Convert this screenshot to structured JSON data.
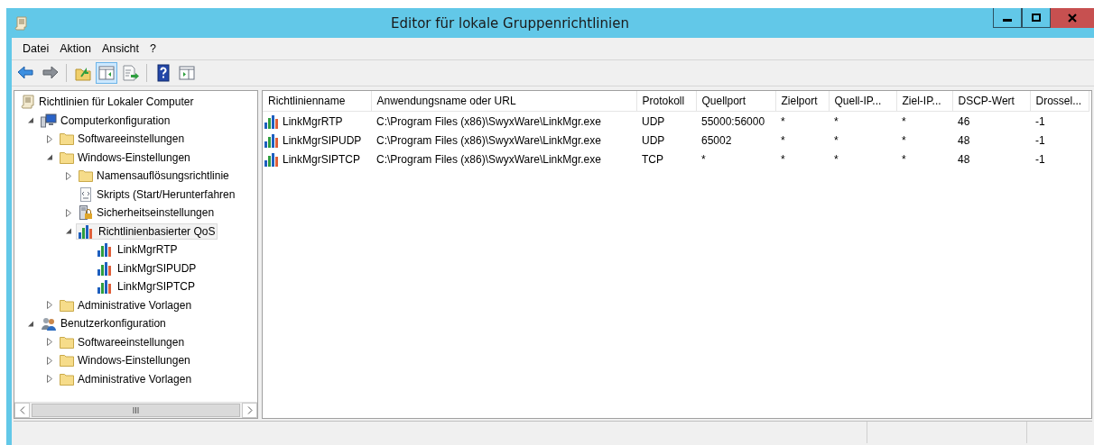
{
  "window": {
    "title": "Editor für lokale Gruppenrichtlinien"
  },
  "menu": [
    "Datei",
    "Aktion",
    "Ansicht",
    "?"
  ],
  "toolbar": [
    {
      "kind": "back",
      "pressed": false
    },
    {
      "kind": "forward",
      "pressed": false
    },
    {
      "kind": "sep"
    },
    {
      "kind": "up",
      "pressed": false
    },
    {
      "kind": "tree",
      "pressed": true
    },
    {
      "kind": "export",
      "pressed": false
    },
    {
      "kind": "sep"
    },
    {
      "kind": "help",
      "pressed": false
    },
    {
      "kind": "actionpane",
      "pressed": false
    }
  ],
  "tree": [
    {
      "label": "Richtlinien für Lokaler Computer",
      "kind": "scroll",
      "selected": false,
      "children": [
        {
          "label": "Computerkonfiguration",
          "kind": "computer",
          "expanded": true,
          "selected": false,
          "children": [
            {
              "label": "Softwareeinstellungen",
              "kind": "folder",
              "expanded": false,
              "selected": false
            },
            {
              "label": "Windows-Einstellungen",
              "kind": "folder",
              "expanded": true,
              "selected": false,
              "children": [
                {
                  "label": "Namensauflösungsrichtlinie",
                  "kind": "folder",
                  "expanded": false,
                  "selected": false
                },
                {
                  "label": "Skripts (Start/Herunterfahren",
                  "kind": "script",
                  "selected": false
                },
                {
                  "label": "Sicherheitseinstellungen",
                  "kind": "security",
                  "expanded": false,
                  "selected": false
                },
                {
                  "label": "Richtlinienbasierter QoS",
                  "kind": "qos",
                  "expanded": true,
                  "selected": true,
                  "children": [
                    {
                      "label": "LinkMgrRTP",
                      "kind": "qos",
                      "selected": false
                    },
                    {
                      "label": "LinkMgrSIPUDP",
                      "kind": "qos",
                      "selected": false
                    },
                    {
                      "label": "LinkMgrSIPTCP",
                      "kind": "qos",
                      "selected": false
                    }
                  ]
                }
              ]
            },
            {
              "label": "Administrative Vorlagen",
              "kind": "folder",
              "expanded": false,
              "selected": false
            }
          ]
        },
        {
          "label": "Benutzerkonfiguration",
          "kind": "user",
          "expanded": true,
          "selected": false,
          "children": [
            {
              "label": "Softwareeinstellungen",
              "kind": "folder",
              "expanded": false,
              "selected": false
            },
            {
              "label": "Windows-Einstellungen",
              "kind": "folder",
              "expanded": false,
              "selected": false
            },
            {
              "label": "Administrative Vorlagen",
              "kind": "folder",
              "expanded": false,
              "selected": false
            }
          ]
        }
      ]
    }
  ],
  "table": {
    "columns": [
      "Richtlinienname",
      "Anwendungsname oder URL",
      "Protokoll",
      "Quellport",
      "Zielport",
      "Quell-IP...",
      "Ziel-IP...",
      "DSCP-Wert",
      "Drossel..."
    ],
    "rows": [
      {
        "selected": false,
        "cells": [
          "LinkMgrRTP",
          "C:\\Program Files (x86)\\SwyxWare\\LinkMgr.exe",
          "UDP",
          "55000:56000",
          "*",
          "*",
          "*",
          "46",
          "-1"
        ]
      },
      {
        "selected": false,
        "cells": [
          "LinkMgrSIPUDP",
          "C:\\Program Files (x86)\\SwyxWare\\LinkMgr.exe",
          "UDP",
          "65002",
          "*",
          "*",
          "*",
          "48",
          "-1"
        ]
      },
      {
        "selected": false,
        "cells": [
          "LinkMgrSIPTCP",
          "C:\\Program Files (x86)\\SwyxWare\\LinkMgr.exe",
          "TCP",
          "*",
          "*",
          "*",
          "*",
          "48",
          "-1"
        ]
      }
    ]
  }
}
